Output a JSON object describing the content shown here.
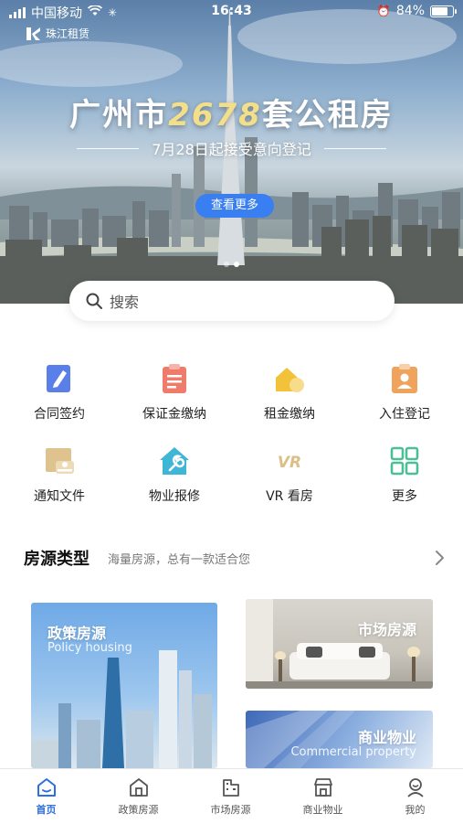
{
  "status_bar": {
    "carrier": "中国移动",
    "time": "16:43",
    "battery": "84%",
    "battery_level": 0.84
  },
  "hero": {
    "brand": "珠江租赁",
    "title_prefix": "广州市",
    "title_number": "2678",
    "title_suffix": "套公租房",
    "subtitle": "7月28日起接受意向登记",
    "button_label": "查看更多",
    "slide_count": 2,
    "active_slide": 1
  },
  "search": {
    "placeholder": "搜索"
  },
  "services": [
    {
      "label": "合同签约",
      "icon": "contract-sign-icon"
    },
    {
      "label": "保证金缴纳",
      "icon": "deposit-icon"
    },
    {
      "label": "租金缴纳",
      "icon": "rent-payment-icon"
    },
    {
      "label": "入住登记",
      "icon": "check-in-icon"
    },
    {
      "label": "通知文件",
      "icon": "notice-file-icon"
    },
    {
      "label": "物业报修",
      "icon": "repair-icon"
    },
    {
      "label": "VR 看房",
      "icon": "vr-icon"
    },
    {
      "label": "更多",
      "icon": "more-grid-icon"
    }
  ],
  "section": {
    "title": "房源类型",
    "subtitle": "海量房源，总有一款适合您"
  },
  "cards": [
    {
      "title": "政策房源",
      "subtitle": "Policy housing"
    },
    {
      "title": "市场房源",
      "subtitle": ""
    },
    {
      "title": "商业物业",
      "subtitle": "Commercial property"
    }
  ],
  "tabs": [
    {
      "label": "首页",
      "active": true
    },
    {
      "label": "政策房源",
      "active": false
    },
    {
      "label": "市场房源",
      "active": false
    },
    {
      "label": "商业物业",
      "active": false
    },
    {
      "label": "我的",
      "active": false
    }
  ],
  "colors": {
    "accent": "#2d6fe0",
    "hero_button": "#3a7ff2",
    "title_highlight": "#f3de8a"
  }
}
